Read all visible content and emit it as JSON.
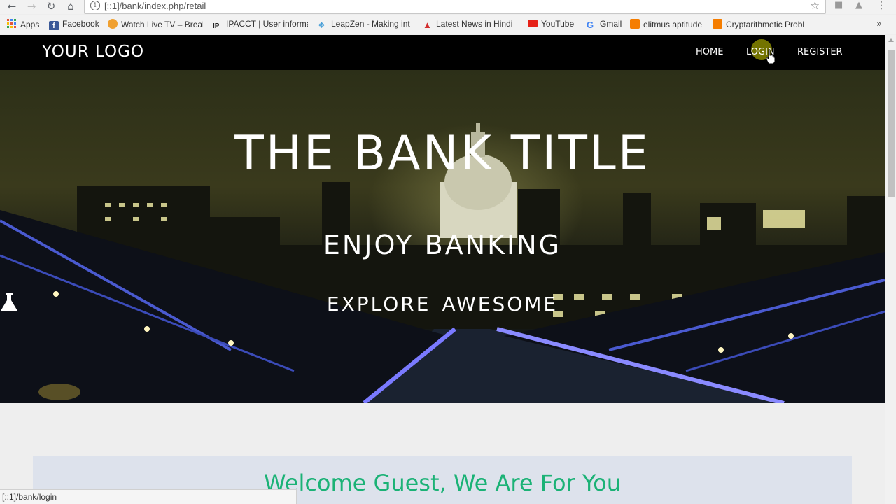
{
  "browser": {
    "url": "[::1]/bank/index.php/retail",
    "bookmarks": [
      {
        "label": "Apps",
        "icon": "apps-grid-icon",
        "color": "#e0543f"
      },
      {
        "label": "Facebook",
        "icon": "facebook-icon",
        "color": "#3b5998"
      },
      {
        "label": "Watch Live TV – Break",
        "icon": "watch-live-tv-icon",
        "color": "#f0a030"
      },
      {
        "label": "IPACCT | User informa",
        "icon": "ipacct-icon",
        "color": "#222222"
      },
      {
        "label": "LeapZen - Making int",
        "icon": "leapzen-icon",
        "color": "#4aa0d8"
      },
      {
        "label": "Latest News in Hindi",
        "icon": "news-icon",
        "color": "#d32f2f"
      },
      {
        "label": "YouTube",
        "icon": "youtube-icon",
        "color": "#e62117"
      },
      {
        "label": "Gmail",
        "icon": "google-icon",
        "color": "#4285f4"
      },
      {
        "label": "elitmus aptitude",
        "icon": "blogger-icon",
        "color": "#f57d00"
      },
      {
        "label": "Cryptarithmetic Probl",
        "icon": "blogger-icon",
        "color": "#f57d00"
      }
    ],
    "more_bookmarks": "»",
    "status_text": "[::1]/bank/login"
  },
  "site": {
    "logo": "YOUR LOGO",
    "nav": [
      {
        "label": "HOME"
      },
      {
        "label": "LOGIN"
      },
      {
        "label": "REGISTER"
      }
    ]
  },
  "hero": {
    "title": "THE BANK TITLE",
    "subtitle": "ENJOY BANKING",
    "explore_left": "EXPLORE",
    "explore_icon": "flask-icon",
    "explore_right": "AWESOME"
  },
  "welcome": {
    "heading": "Welcome Guest, We Are For You"
  },
  "colors": {
    "navbar": "#000000",
    "welcome_text": "#1bb276",
    "welcome_bg": "#dde2ec",
    "bridge_light": "#6a6aff"
  }
}
